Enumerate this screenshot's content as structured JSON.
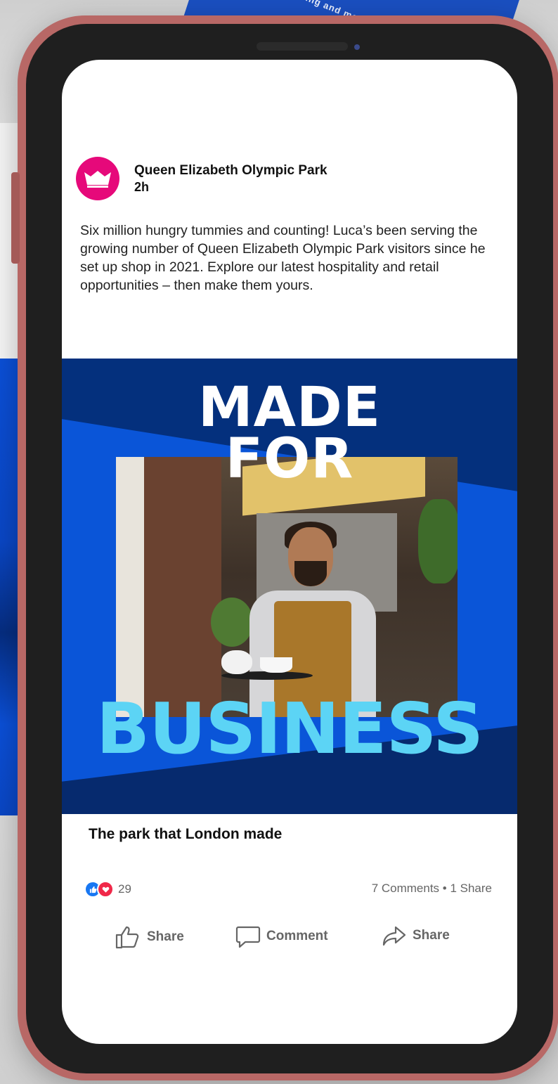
{
  "background": {
    "tablet_text": "evening and more"
  },
  "post": {
    "page_name": "Queen Elizabeth Olympic Park",
    "time": "2h",
    "text": "Six million hungry tummies and counting! Luca’s been serving the growing number of Queen Elizabeth Olympic Park visitors since he set up shop in 2021. Explore our latest hospitality and retail opportunities – then make them yours.",
    "creative": {
      "line1": "MADE",
      "line2": "FOR",
      "line3": "BUSINESS"
    },
    "link_caption": "The park that London made",
    "reaction_count": "29",
    "engagement": "7 Comments • 1 Share",
    "actions": {
      "like_label": "Share",
      "comment_label": "Comment",
      "share_label": "Share"
    }
  },
  "colors": {
    "brand_pink": "#e6097a",
    "creative_navy": "#04307d",
    "creative_blue": "#0a55d8",
    "creative_cyan": "#5cd4f5",
    "phone_case": "#b86866"
  }
}
